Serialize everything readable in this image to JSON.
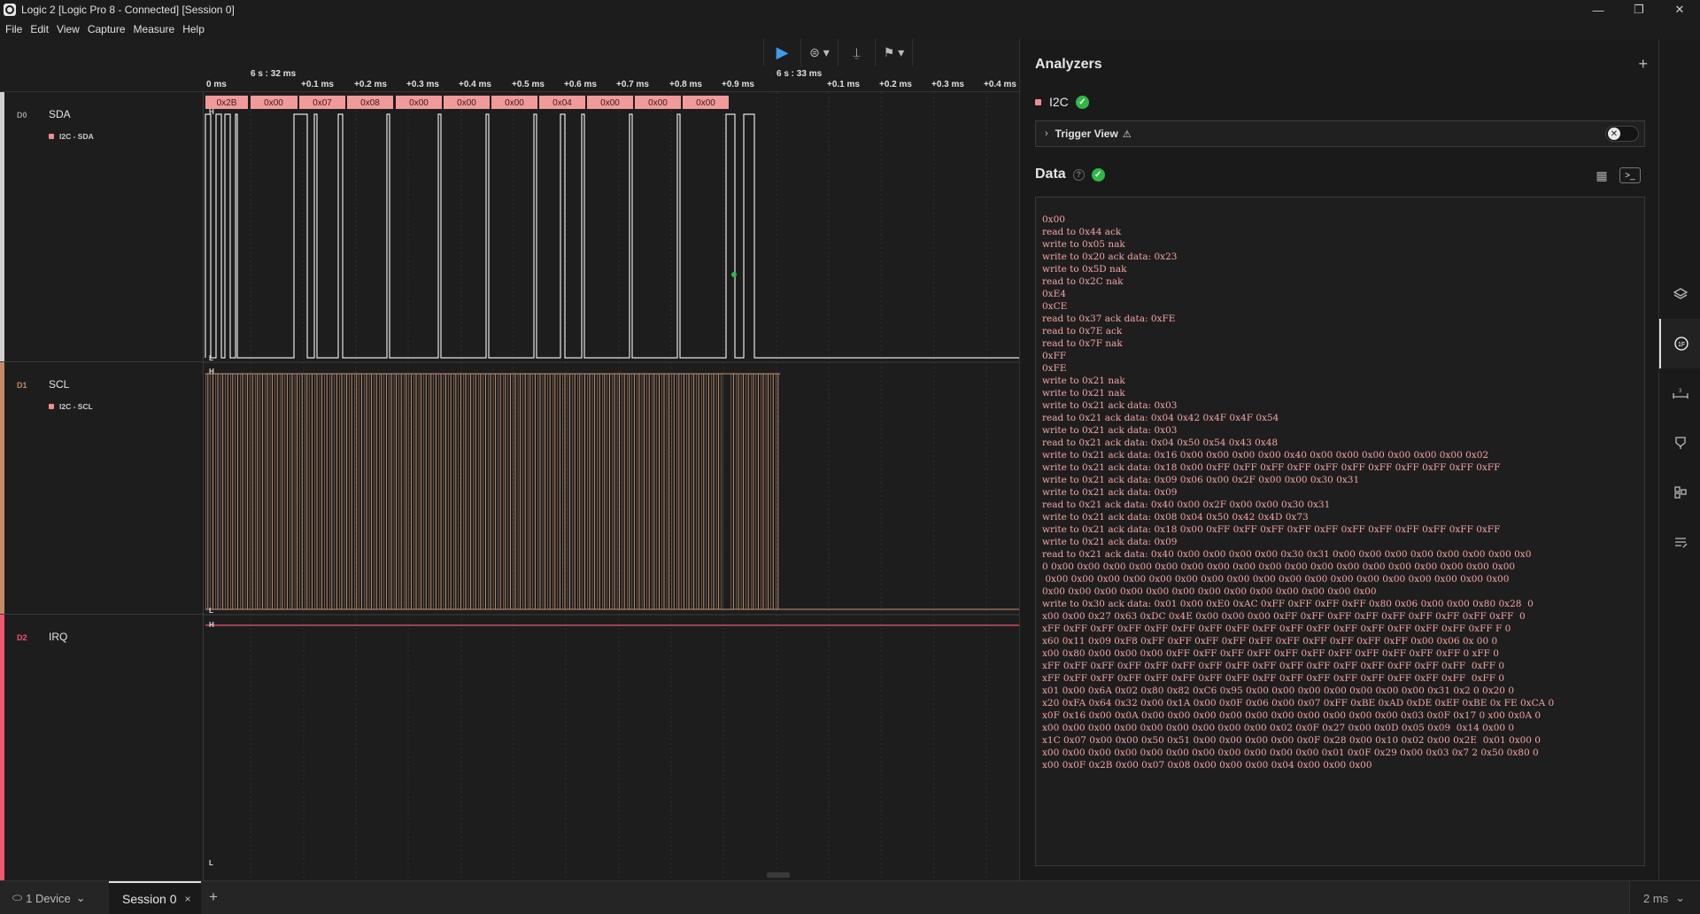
{
  "window": {
    "title": "Logic 2 [Logic Pro 8 - Connected] [Session 0]",
    "minimize_icon": "—",
    "restore_icon": "❐",
    "close_icon": "✕"
  },
  "menu": [
    "File",
    "Edit",
    "View",
    "Capture",
    "Measure",
    "Help"
  ],
  "toolbar": {
    "play_icon": "▶",
    "trigger_icon": "⊜ ▾",
    "measure_icon": "⍊",
    "marker_icon": "⚑ ▾"
  },
  "ruler": {
    "major": [
      "6 s : 32 ms",
      "6 s : 33 ms"
    ],
    "left_edge": "0 ms",
    "minor": [
      "+0.1 ms",
      "+0.2 ms",
      "+0.3 ms",
      "+0.4 ms",
      "+0.5 ms",
      "+0.6 ms",
      "+0.7 ms",
      "+0.8 ms",
      "+0.9 ms",
      "+0.1 ms",
      "+0.2 ms",
      "+0.3 ms",
      "+0.4 ms"
    ]
  },
  "channels": [
    {
      "id": "D0",
      "name": "SDA",
      "analyzer": "I2C - SDA",
      "color": "#e8e8e8"
    },
    {
      "id": "D1",
      "name": "SCL",
      "analyzer": "I2C - SCL",
      "color": "#d9a07e"
    },
    {
      "id": "D2",
      "name": "IRQ",
      "analyzer": "",
      "color": "#f0566f"
    }
  ],
  "decoded_bytes": [
    "0x2B",
    "0x00",
    "0x07",
    "0x08",
    "0x00",
    "0x00",
    "0x00",
    "0x04",
    "0x00",
    "0x00",
    "0x00"
  ],
  "level_labels": {
    "high": "H",
    "low": "L"
  },
  "analyzers_panel": {
    "title": "Analyzers",
    "add_icon": "+",
    "analyzer_name": "I2C",
    "status_icon": "✓",
    "trigger_view_label": "Trigger View",
    "warning_icon": "⚠",
    "toggle_icon": "✕",
    "data_title": "Data",
    "help_icon": "?",
    "table_view_icon": "▦",
    "terminal_view_icon": ">_"
  },
  "terminal_lines": [
    "0x00",
    "read to 0x44 ack",
    "write to 0x05 nak",
    "write to 0x20 ack data: 0x23",
    "write to 0x5D nak",
    "read to 0x2C nak",
    "0xE4",
    "0xCE",
    "read to 0x37 ack data: 0xFE",
    "read to 0x7E ack",
    "read to 0x7F nak",
    "0xFF",
    "0xFE",
    "write to 0x21 nak",
    "write to 0x21 nak",
    "write to 0x21 ack data: 0x03",
    "read to 0x21 ack data: 0x04 0x42 0x4F 0x4F 0x54",
    "write to 0x21 ack data: 0x03",
    "read to 0x21 ack data: 0x04 0x50 0x54 0x43 0x48",
    "write to 0x21 ack data: 0x16 0x00 0x00 0x00 0x00 0x40 0x00 0x00 0x00 0x00 0x00 0x00 0x02",
    "write to 0x21 ack data: 0x18 0x00 0xFF 0xFF 0xFF 0xFF 0xFF 0xFF 0xFF 0xFF 0xFF 0xFF 0xFF",
    "write to 0x21 ack data: 0x09 0x06 0x00 0x2F 0x00 0x00 0x30 0x31",
    "write to 0x21 ack data: 0x09",
    "read to 0x21 ack data: 0x40 0x00 0x2F 0x00 0x00 0x30 0x31",
    "write to 0x21 ack data: 0x08 0x04 0x50 0x42 0x4D 0x73",
    "write to 0x21 ack data: 0x18 0x00 0xFF 0xFF 0xFF 0xFF 0xFF 0xFF 0xFF 0xFF 0xFF 0xFF 0xFF",
    "write to 0x21 ack data: 0x09",
    "read to 0x21 ack data: 0x40 0x00 0x00 0x00 0x00 0x30 0x31 0x00 0x00 0x00 0x00 0x00 0x00 0x00 0x0",
    "0 0x00 0x00 0x00 0x00 0x00 0x00 0x00 0x00 0x00 0x00 0x00 0x00 0x00 0x00 0x00 0x00 0x00 0x00",
    " 0x00 0x00 0x00 0x00 0x00 0x00 0x00 0x00 0x00 0x00 0x00 0x00 0x00 0x00 0x00 0x00 0x00 0x00",
    "0x00 0x00 0x00 0x00 0x00 0x00 0x00 0x00 0x00 0x00 0x00 0x00 0x00",
    "write to 0x30 ack data: 0x01 0x00 0xE0 0xAC 0xFF 0xFF 0xFF 0xFF 0x80 0x06 0x00 0x00 0x80 0x28  0",
    "x00 0x00 0x27 0x63 0xDC 0x4E 0x00 0x00 0x00 0xFF 0xFF 0xFF 0xFF 0xFF 0xFF 0xFF 0xFF 0xFF  0",
    "xFF 0xFF 0xFF 0xFF 0xFF 0xFF 0xFF 0xFF 0xFF 0xFF 0xFF 0xFF 0xFF 0xFF 0xFF 0xFF 0xFF F 0",
    "x60 0x11 0x09 0xF8 0xFF 0xFF 0xFF 0xFF 0xFF 0xFF 0xFF 0xFF 0xFF 0xFF 0x00 0x06 0x 00 0",
    "x00 0x80 0x00 0x00 0x00 0xFF 0xFF 0xFF 0xFF 0xFF 0xFF 0xFF 0xFF 0xFF 0xFF 0xFF 0 xFF 0",
    "xFF 0xFF 0xFF 0xFF 0xFF 0xFF 0xFF 0xFF 0xFF 0xFF 0xFF 0xFF 0xFF 0xFF 0xFF 0xFF  0xFF 0",
    "xFF 0xFF 0xFF 0xFF 0xFF 0xFF 0xFF 0xFF 0xFF 0xFF 0xFF 0xFF 0xFF 0xFF 0xFF 0xFF  0xFF 0",
    "x01 0x00 0x6A 0x02 0x80 0x82 0xC6 0x95 0x00 0x00 0x00 0x00 0x00 0x00 0x00 0x31 0x2 0 0x20 0",
    "x20 0xFA 0x64 0x32 0x00 0x1A 0x00 0x0F 0x06 0x00 0x07 0xFF 0xBE 0xAD 0xDE 0xEF 0xBE 0x FE 0xCA 0",
    "x0F 0x16 0x00 0x0A 0x00 0x00 0x00 0x00 0x00 0x00 0x00 0x00 0x00 0x00 0x03 0x0F 0x17 0 x00 0x0A 0",
    "x00 0x00 0x00 0x00 0x00 0x00 0x00 0x00 0x00 0x02 0x0F 0x27 0x00 0x0D 0x05 0x09  0x14 0x00 0",
    "x1C 0x07 0x00 0x00 0x50 0x51 0x00 0x00 0x00 0x00 0x0F 0x28 0x00 0x10 0x02 0x00 0x2E  0x01 0x00 0",
    "x00 0x00 0x00 0x00 0x00 0x00 0x00 0x00 0x00 0x00 0x00 0x01 0x0F 0x29 0x00 0x03 0x7 2 0x50 0x80 0",
    "x00 0x0F 0x2B 0x00 0x07 0x08 0x00 0x00 0x00 0x04 0x00 0x00 0x00"
  ],
  "side_icons": [
    "layers-icon",
    "analyzers-icon",
    "timing-icon",
    "marker-icon",
    "extensions-icon",
    "notes-icon"
  ],
  "bottom": {
    "device_label": "1 Device",
    "device_icon": "⬭",
    "device_chevron": "⌄",
    "session_label": "Session 0",
    "session_close": "×",
    "add_icon": "+",
    "zoom_label": "2 ms",
    "zoom_chevron": "⌄"
  }
}
